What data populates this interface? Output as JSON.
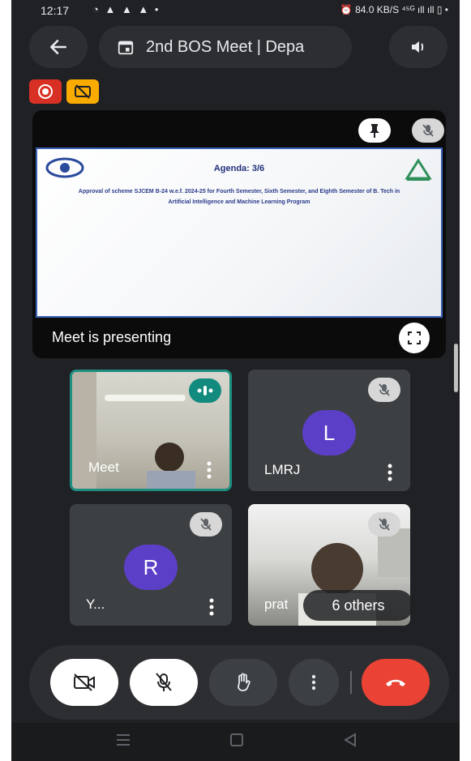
{
  "status_bar": {
    "time": "12:17",
    "notifications": "◔ ▲ ▲ ▲ •",
    "right_icons": "⏰ 84.0 KB/S ⁴⁵ᴳ ıll ıll ▯ •"
  },
  "header": {
    "title": "2nd BOS Meet | Depa",
    "back_icon": "arrow-left-icon",
    "speaker_icon": "speaker-icon"
  },
  "indicators": {
    "recording_icon": "record-icon",
    "captions_off_icon": "captions-off-icon",
    "recording_color": "#d93025",
    "captions_color": "#f9ab00"
  },
  "presentation": {
    "slide_title": "Agenda: 3/6",
    "slide_text": "Approval of scheme SJCEM B-24 w.e.f. 2024-25 for Fourth Semester, Sixth Semester, and Eighth Semester of B. Tech in Artificial Intelligence and Machine Learning Program",
    "presenting_label": "Meet is presenting"
  },
  "participants": [
    {
      "name": "Meet",
      "initial": "",
      "speaking": true
    },
    {
      "name": "LMRJ",
      "initial": "L",
      "muted": true
    },
    {
      "name": "Y...",
      "initial": "R",
      "muted": true
    },
    {
      "name": "prat",
      "initial": "",
      "muted": true
    }
  ],
  "others_label": "6 others",
  "controls": {
    "camera_icon": "camera-off-icon",
    "mic_icon": "mic-off-icon",
    "hand_icon": "raise-hand-icon",
    "more_icon": "more-vert-icon",
    "end_icon": "end-call-icon",
    "end_color": "#ea4335"
  }
}
